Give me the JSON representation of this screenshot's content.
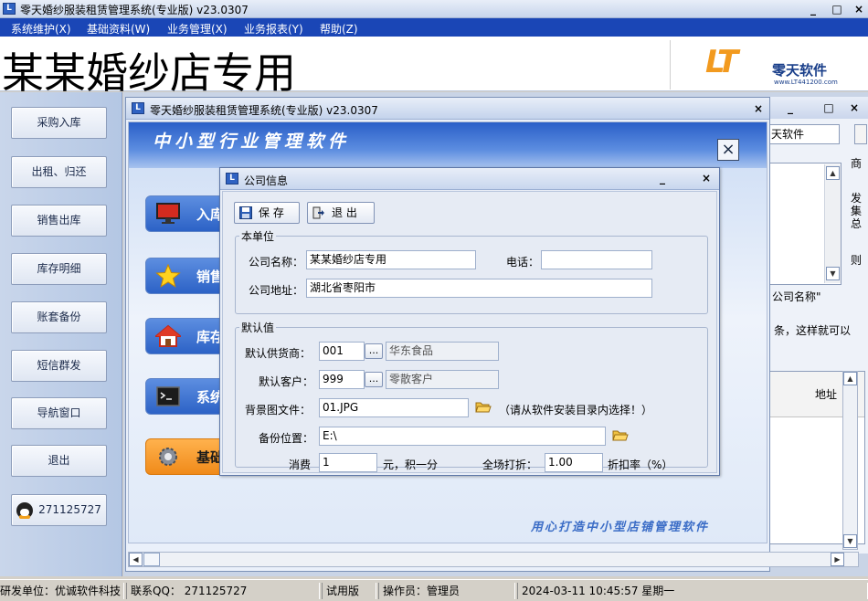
{
  "app": {
    "title": "零天婚纱服装租赁管理系统(专业版)  v23.0307",
    "window_controls": [
      "_",
      "□",
      "×"
    ]
  },
  "menu": [
    "系统维护(X)",
    "基础资料(W)",
    "业务管理(X)",
    "业务报表(Y)",
    "帮助(Z)"
  ],
  "banner": {
    "store_name": "某某婚纱店专用",
    "logo_mark": "LT",
    "logo_text": "零天软件",
    "logo_url": "www.LT441200.com"
  },
  "sidebar": [
    "采购入库",
    "出租、归还",
    "销售出库",
    "库存明细",
    "账套备份",
    "短信群发",
    "导航窗口",
    "退出"
  ],
  "qq_button": "271125727",
  "module_window": {
    "title": "零天婚纱服装租赁管理系统(专业版)  v23.0307",
    "slogan": "中小型行业管理软件",
    "close": "×",
    "modules": [
      "入库",
      "销售",
      "库存",
      "系统",
      "基础"
    ],
    "footer": "用心打造中小型店铺管理软件"
  },
  "back_window": {
    "field_text": "天软件",
    "side_texts": [
      "商",
      "发",
      "集",
      "总",
      "则"
    ],
    "memo_text": "公司名称\"",
    "line_text": "条，这样就可以",
    "grid_header": "地址"
  },
  "dialog": {
    "title": "公司信息",
    "save_button": "保 存",
    "exit_button": "退 出",
    "unit_group": "本单位",
    "company_name_label": "公司名称：",
    "company_name": "某某婚纱店专用",
    "phone_label": "电话：",
    "phone": "",
    "address_label": "公司地址：",
    "address": "湖北省枣阳市",
    "default_group": "默认值",
    "supplier_label": "默认供货商：",
    "supplier_code": "001",
    "supplier_name": "华东食品",
    "customer_label": "默认客户：",
    "customer_code": "999",
    "customer_name": "零散客户",
    "bg_label": "背景图文件：",
    "bg_file": "01.JPG",
    "bg_hint": "（请从软件安装目录内选择！）",
    "backup_label": "备份位置：",
    "backup_path": "E:\\",
    "consume_label": "消费",
    "consume_value": "1",
    "points_text": "元，积一分",
    "discount_label": "全场打折：",
    "discount_value": "1.00",
    "discount_unit": "折扣率（%）",
    "ellipsis": "..."
  },
  "status": {
    "developer": "研发单位：优诚软件科技",
    "qq": "联系QQ：  271125727",
    "edition": "试用版",
    "operator": "操作员：管理员",
    "datetime": "2024-03-11  10:45:57  星期一"
  },
  "colors": {
    "menu_bg": "#1a46b6",
    "header_blue": "#2a5fc8",
    "orange": "#f08a1a"
  }
}
